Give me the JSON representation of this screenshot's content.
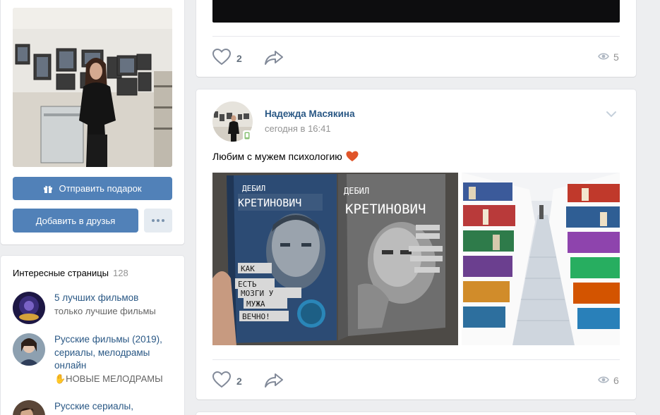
{
  "profile": {
    "gift_button_label": "Отправить подарок",
    "add_friend_label": "Добавить в друзья"
  },
  "interesting_pages": {
    "title": "Интересные страницы",
    "count": "128",
    "items": [
      {
        "name": "5 лучших фильмов",
        "description": "только лучшие фильмы"
      },
      {
        "name": "Русские фильмы (2019), сериалы, мелодрамы онлайн",
        "description": "✋НОВЫЕ МЕЛОДРАМЫ"
      },
      {
        "name": "Русские сериалы,",
        "description": ""
      }
    ]
  },
  "post_top": {
    "likes": "2",
    "views": "5"
  },
  "post_main": {
    "author": "Надежда Масякина",
    "date": "сегодня в 16:41",
    "text": "Любим с мужем психологию",
    "likes": "2",
    "views": "6",
    "book_cover_text": {
      "left_author": "Дебил Кретинович",
      "left_title": "Как есть мозги у мужа вечно!",
      "right_author": "Дебил Кретинович"
    }
  },
  "colors": {
    "link": "#2a5885",
    "button": "#5181b8",
    "background": "#edeef0",
    "heart_emoji": "#e0552a"
  },
  "icons": [
    "gift-icon",
    "more-icon",
    "like-icon",
    "share-icon",
    "eye-icon",
    "chevron-down-icon",
    "heart-emoji-icon",
    "mobile-online-icon"
  ]
}
